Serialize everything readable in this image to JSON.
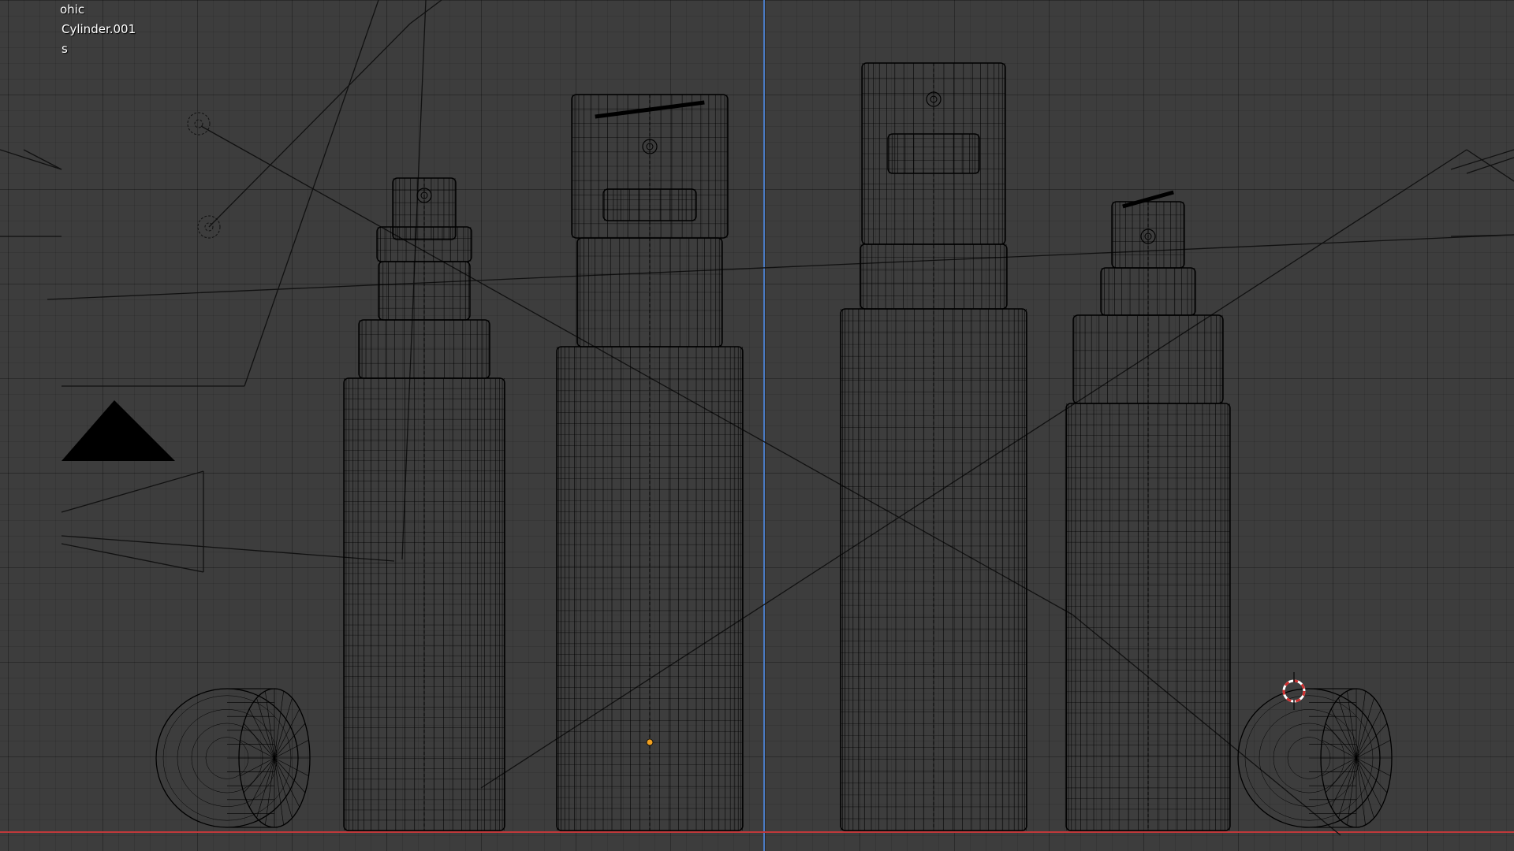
{
  "viewport": {
    "overlay": {
      "view_mode": "ohic",
      "object_name": "Cylinder.001",
      "third_line": "s"
    },
    "colors": {
      "background": "#3d3d3d",
      "wire": "#000000",
      "axis_x": "#c0393b",
      "axis_z": "#4a7bc4",
      "origin": "#f0a020",
      "cursor": "#d03030"
    },
    "objects": [
      {
        "name": "cap-lying-left",
        "icon": "cylinder-icon"
      },
      {
        "name": "bottle-1",
        "icon": "spray-bottle-icon"
      },
      {
        "name": "bottle-2",
        "icon": "spray-bottle-icon"
      },
      {
        "name": "bottle-3",
        "icon": "spray-bottle-icon"
      },
      {
        "name": "bottle-4",
        "icon": "spray-bottle-icon"
      },
      {
        "name": "cap-lying-right",
        "icon": "cylinder-icon"
      }
    ]
  }
}
